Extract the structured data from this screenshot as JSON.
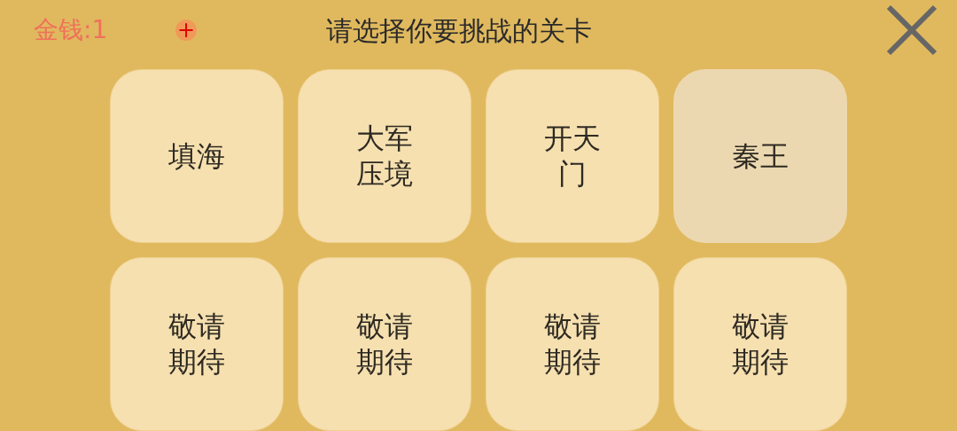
{
  "coins": {
    "label": "金钱:1",
    "add": "+"
  },
  "title": "请选择你要挑战的关卡",
  "levels": [
    {
      "name": "填海",
      "selected": false
    },
    {
      "name": "大军压境",
      "selected": false
    },
    {
      "name": "开天门",
      "selected": false
    },
    {
      "name": "秦王",
      "selected": true
    },
    {
      "name": "敬请期待",
      "selected": false
    },
    {
      "name": "敬请期待",
      "selected": false
    },
    {
      "name": "敬请期待",
      "selected": false
    },
    {
      "name": "敬请期待",
      "selected": false
    }
  ]
}
